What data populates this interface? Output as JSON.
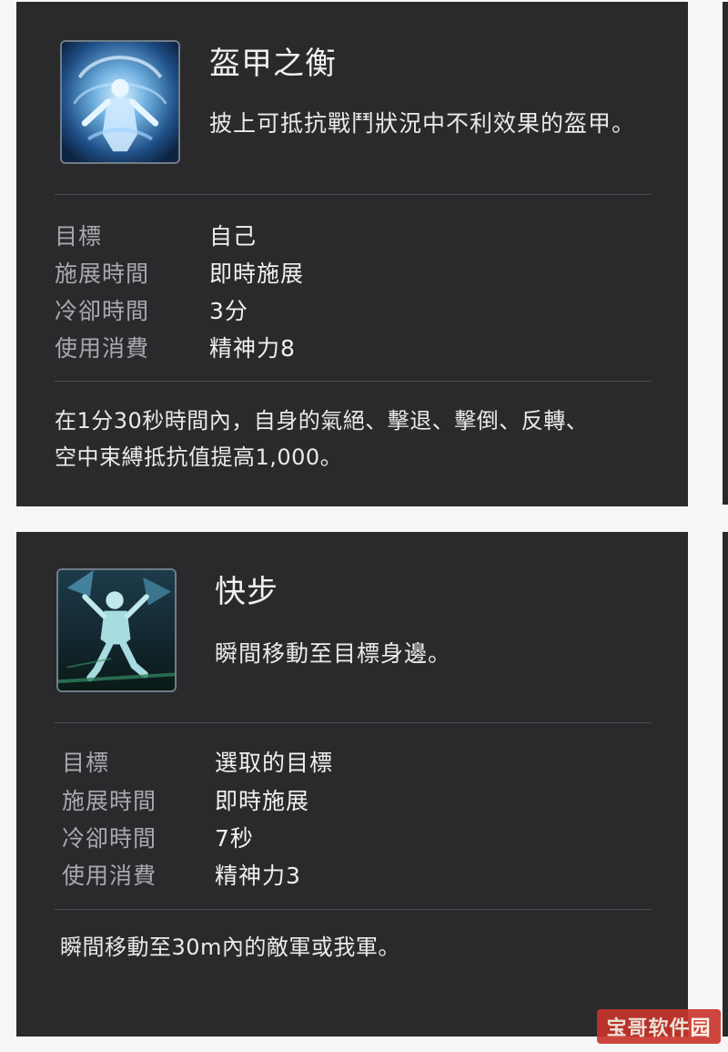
{
  "skills": [
    {
      "icon": "armor-skill-icon",
      "title": "盔甲之衡",
      "description": "披上可抵抗戰鬥狀況中不利效果的盔甲。",
      "stats": [
        {
          "label": "目標",
          "value": "自己"
        },
        {
          "label": "施展時間",
          "value": "即時施展"
        },
        {
          "label": "冷卻時間",
          "value": "3分"
        },
        {
          "label": "使用消費",
          "value": "精神力8"
        }
      ],
      "detail_lines": [
        "在1分30秒時間內，自身的氣絕、擊退、擊倒、反轉、",
        "空中束縛抵抗值提高1,000。"
      ]
    },
    {
      "icon": "quickstep-skill-icon",
      "title": "快步",
      "description": "瞬間移動至目標身邊。",
      "stats": [
        {
          "label": "目標",
          "value": "選取的目標"
        },
        {
          "label": "施展時間",
          "value": "即時施展"
        },
        {
          "label": "冷卻時間",
          "value": "7秒"
        },
        {
          "label": "使用消費",
          "value": "精神力3"
        }
      ],
      "detail_lines": [
        "瞬間移動至30m內的敵軍或我軍。"
      ]
    }
  ],
  "watermark": "宝哥软件园",
  "colors": {
    "card_background": "#2a2a2d",
    "page_background": "#f6f6f6",
    "label_color": "#a9a9ad",
    "value_color": "#f0f0f0",
    "watermark_background": "#c8342a"
  }
}
